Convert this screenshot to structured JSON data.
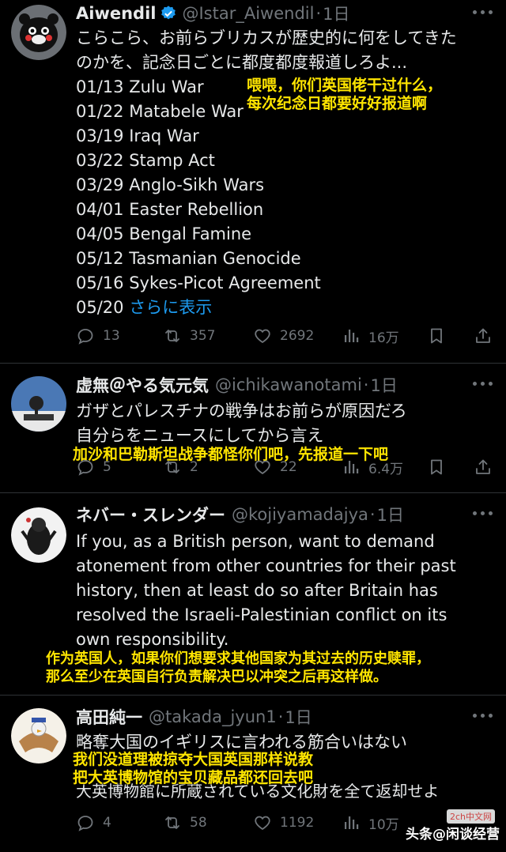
{
  "tweets": [
    {
      "name": "Aiwendil",
      "verified": true,
      "handle": "@Istar_Aiwendil",
      "time": "1日",
      "lines": [
        "こらこら、お前らブリカスが歴史的に何をしてきた",
        "のかを、記念日ごとに都度都度報道しろよ...",
        "01/13 Zulu War",
        "01/22 Matabele War",
        "03/19 Iraq War",
        "03/22 Stamp Act",
        "03/29 Anglo-Sikh Wars",
        "04/01 Easter Rebellion",
        "04/05 Bengal Famine",
        "05/12 Tasmanian Genocide",
        "05/16 Sykes-Picot Agreement"
      ],
      "last_prefix": "05/20 ",
      "show_more": "さらに表示",
      "overlay": [
        "喂喂，你们英国佬干过什么，",
        "每次纪念日都要好好报道啊"
      ],
      "stats": {
        "reply": "13",
        "retweet": "357",
        "like": "2692",
        "views": "16万"
      }
    },
    {
      "name": "虚無＠やる気元気",
      "handle": "@ichikawanotami",
      "time": "1日",
      "lines": [
        "ガザとパレスチナの戦争はお前らが原因だろ",
        "自分らをニュースにしてから言え"
      ],
      "overlay": [
        "加沙和巴勒斯坦战争都怪你们吧，先报道一下吧"
      ],
      "stats": {
        "reply": "5",
        "retweet": "2",
        "like": "22",
        "views": "6.4万"
      }
    },
    {
      "name": "ネバー・スレンダー",
      "handle": "@kojiyamadajya",
      "time": "1日",
      "lines": [
        "If you, as a British person, want to demand",
        "atonement from other countries for their past",
        "history, then at least do so after Britain has",
        "resolved the Israeli-Palestinian conflict on its",
        "own responsibility."
      ],
      "overlay": [
        "作为英国人，如果你们想要求其他国家为其过去的历史赎罪，",
        "那么至少在英国自行负责解决巴以冲突之后再这样做。"
      ]
    },
    {
      "name": "高田純一",
      "handle": "@takada_jyun1",
      "time": "1日",
      "lines": [
        "略奪大国のイギリスに言われる筋合いはない",
        "",
        "大英博物館に所蔵されている文化財を全て返却せよ"
      ],
      "overlay": [
        "我们没道理被掠夺大国英国那样说教",
        "把大英博物馆的宝贝藏品都还回去吧"
      ],
      "stats": {
        "reply": "4",
        "retweet": "58",
        "like": "1192",
        "views": "10万"
      }
    }
  ],
  "watermark": {
    "text": "头条@闲谈经营",
    "badge": "2ch中文网"
  },
  "colors": {
    "background": "#000000",
    "text": "#e7e9ea",
    "muted": "#71767b",
    "link": "#1d9bf0",
    "overlay": "#ffe500"
  }
}
